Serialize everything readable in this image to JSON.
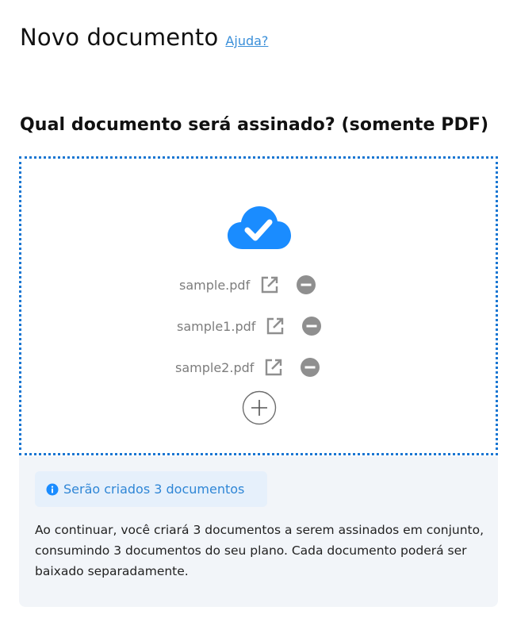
{
  "header": {
    "title": "Novo documento",
    "help_link": "Ajuda?"
  },
  "question": "Qual documento será assinado? (somente PDF)",
  "upload": {
    "status_icon": "cloud-check-icon",
    "files": [
      {
        "name": "sample.pdf"
      },
      {
        "name": "sample1.pdf"
      },
      {
        "name": "sample2.pdf"
      }
    ],
    "open_icon": "external-link-icon",
    "remove_icon": "minus-circle-icon",
    "add_icon": "plus-circle-icon"
  },
  "info": {
    "badge_icon": "info-icon",
    "badge_text": "Serão criados 3 documentos",
    "description": "Ao continuar, você criará 3 documentos a serem assinados em conjunto, consumindo 3 documentos do seu plano. Cada documento poderá ser baixado separadamente."
  },
  "colors": {
    "accent": "#1a8cff",
    "link": "#3a8fd9",
    "dropzone_border": "#1976d2",
    "muted_text": "#7d7d7d",
    "icon_grey": "#8f8f8f",
    "panel_bg": "#f2f5f9",
    "badge_bg": "#e6f0fb",
    "badge_text": "#2f86d6"
  }
}
